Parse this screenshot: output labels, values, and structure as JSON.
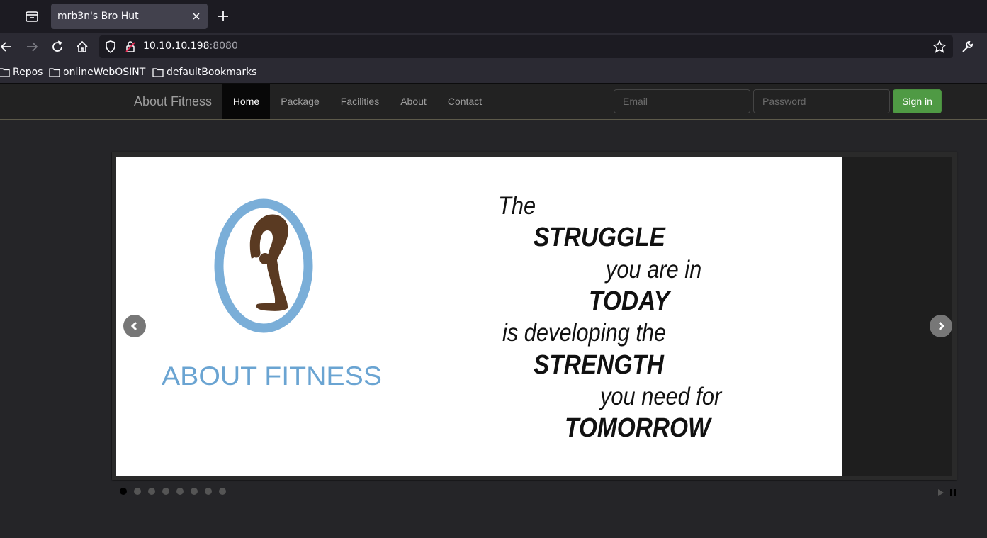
{
  "browser": {
    "tab_title": "mrb3n's Bro Hut",
    "url_host": "10.10.10.198",
    "url_port": ":8080",
    "bookmarks": [
      "Repos",
      "onlineWebOSINT",
      "defaultBookmarks"
    ]
  },
  "site": {
    "brand": "About Fitness",
    "menu": [
      "Home",
      "Package",
      "Facilities",
      "About",
      "Contact"
    ],
    "active_menu": "Home",
    "email_placeholder": "Email",
    "password_placeholder": "Password",
    "signin_label": "Sign in",
    "accent_color": "#4f9a44"
  },
  "carousel": {
    "slide_logo_text": "ABOUT FITNESS",
    "quote_lines": [
      "The",
      "STRUGGLE",
      "you are in",
      "TODAY",
      "is developing the",
      "STRENGTH",
      "you need for",
      "TOMORROW"
    ],
    "slide_count": 8,
    "active_slide": 1,
    "prev_icon": "chevron-left-icon",
    "next_icon": "chevron-right-icon",
    "logo_color": "#6aa4d2"
  }
}
